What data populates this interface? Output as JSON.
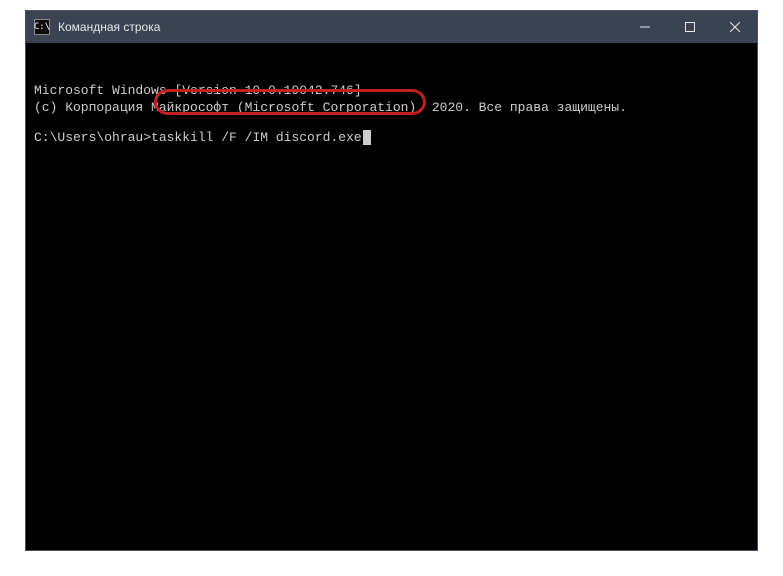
{
  "titlebar": {
    "icon_label": "C:\\",
    "title": "Командная строка"
  },
  "terminal": {
    "line1": "Microsoft Windows [Version 10.0.19042.746]",
    "line2": "(c) Корпорация Майкрософт (Microsoft Corporation), 2020. Все права защищены.",
    "prompt": "C:\\Users\\ohrau>",
    "command": "taskkill /F /IM discord.exe"
  },
  "colors": {
    "titlebar_bg": "#3b4252",
    "terminal_bg": "#000000",
    "highlight": "#c32020"
  }
}
